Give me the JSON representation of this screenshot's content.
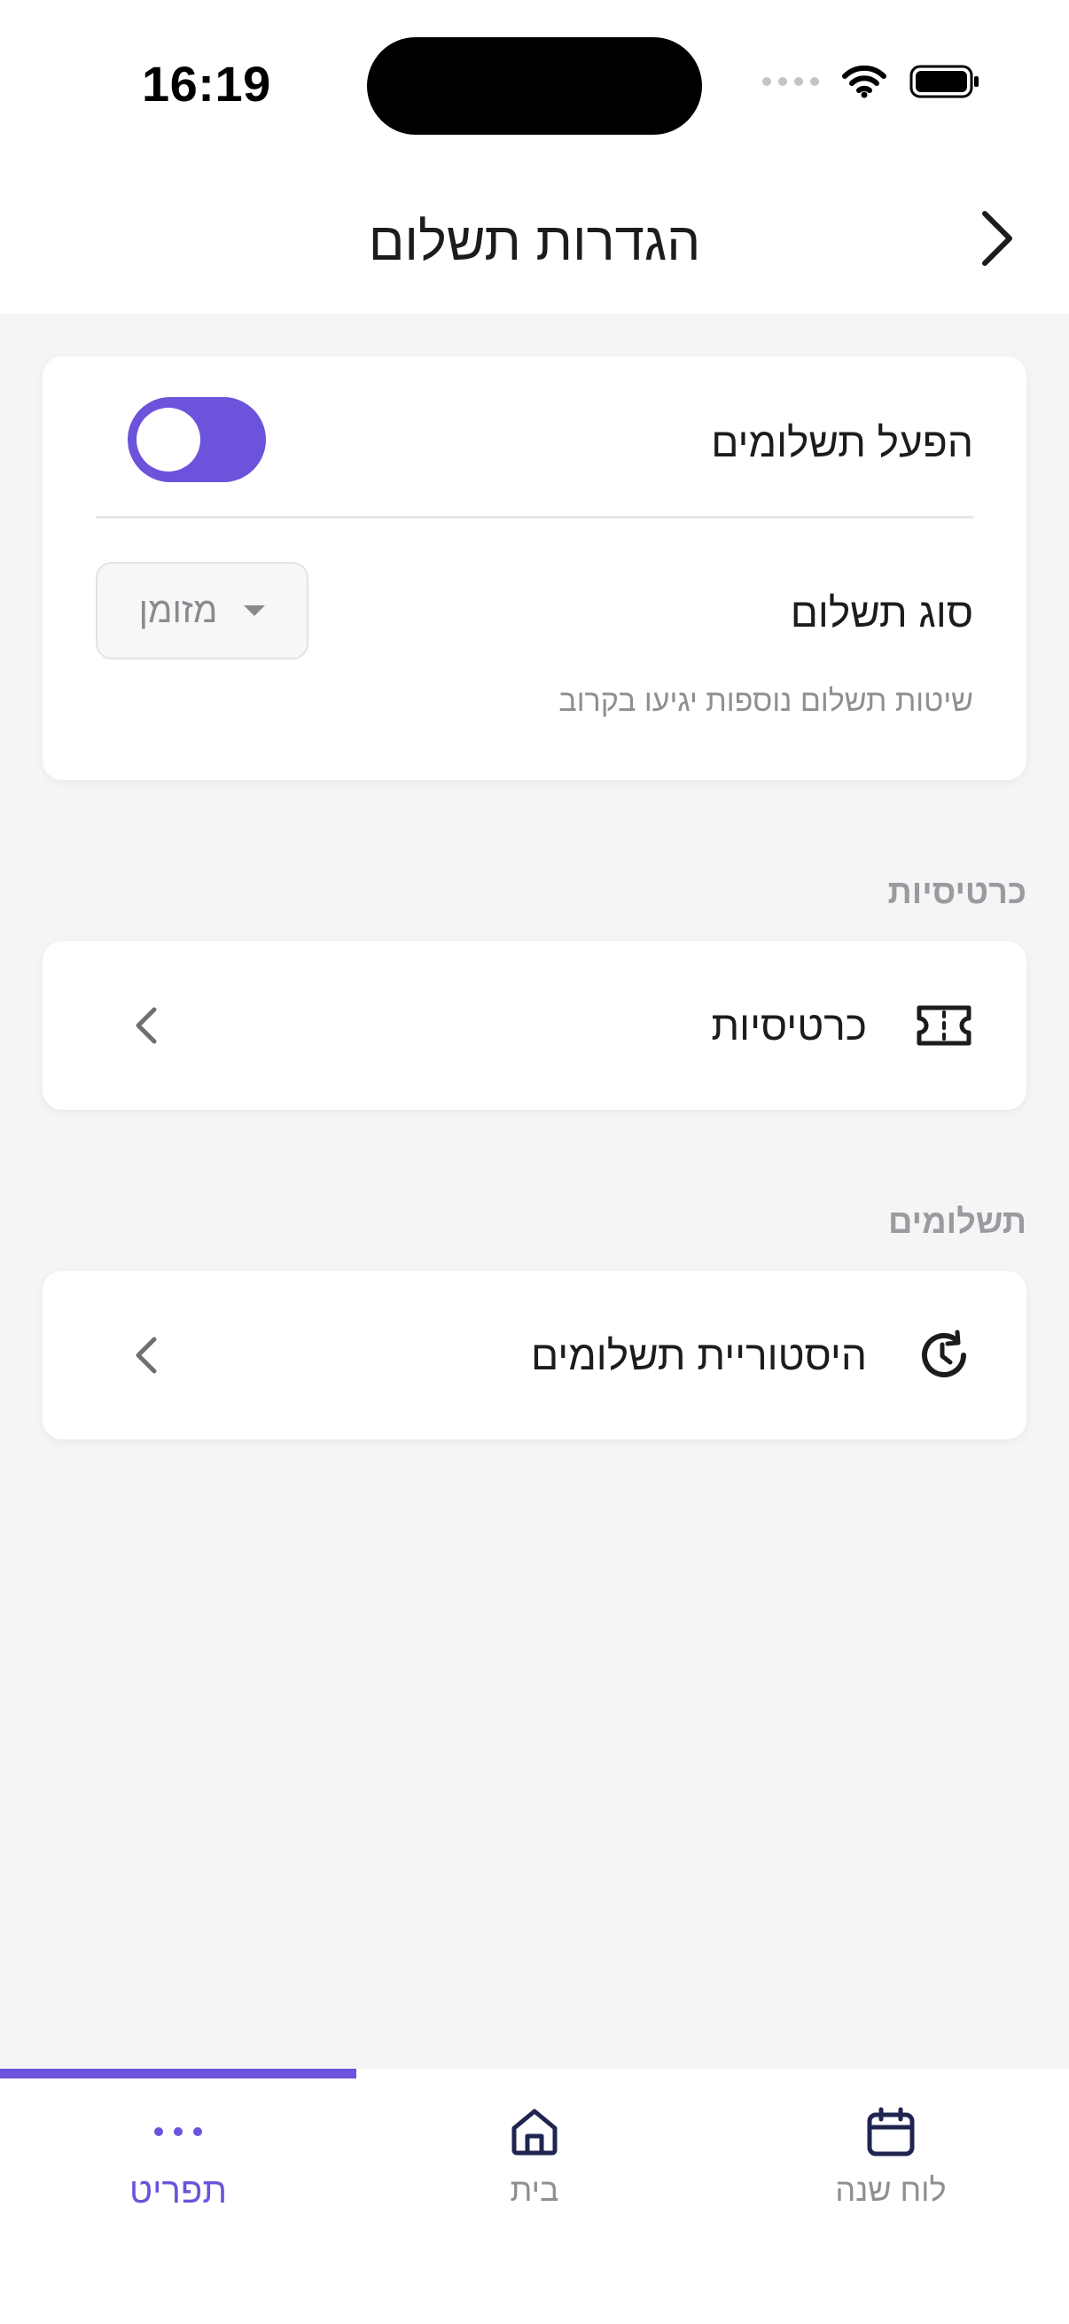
{
  "status_bar": {
    "time": "16:19"
  },
  "header": {
    "title": "הגדרות תשלום",
    "back_icon": "chevron-right-icon"
  },
  "payment_settings": {
    "enable_label": "הפעל תשלומים",
    "enable_state": "on",
    "payment_type_label": "סוג תשלום",
    "payment_type_value": "מזומן",
    "hint": "שיטות תשלום נוספות יגיעו בקרוב"
  },
  "sections": [
    {
      "title": "כרטיסיות",
      "row_label": "כרטיסיות",
      "icon": "ticket-icon"
    },
    {
      "title": "תשלומים",
      "row_label": "היסטוריית תשלומים",
      "icon": "history-clock-icon"
    }
  ],
  "tab_bar": {
    "tabs": [
      {
        "label": "תפריט",
        "icon": "more-dots-icon",
        "active": true
      },
      {
        "label": "בית",
        "icon": "home-icon",
        "active": false
      },
      {
        "label": "לוח שנה",
        "icon": "calendar-icon",
        "active": false
      }
    ]
  },
  "colors": {
    "accent": "#6d53dc",
    "background": "#f5f5f6",
    "card": "#ffffff",
    "muted_text": "#8e8e93",
    "tab_icon": "#1f2550"
  }
}
